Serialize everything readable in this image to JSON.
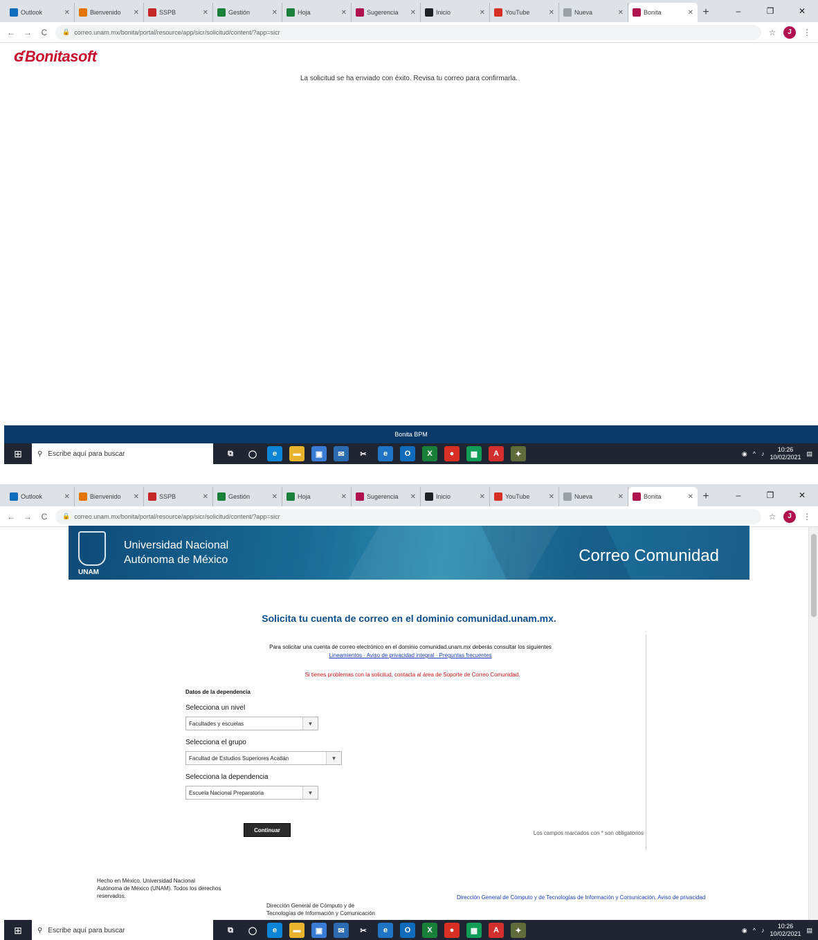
{
  "browser": {
    "tabs": [
      {
        "title": "Outlook",
        "color": "#0f6cbd"
      },
      {
        "title": "Bienvenido",
        "color": "#e37400"
      },
      {
        "title": "SSPB",
        "color": "#c62828"
      },
      {
        "title": "Gestión",
        "color": "#188038"
      },
      {
        "title": "Hoja",
        "color": "#188038"
      },
      {
        "title": "Sugerencia",
        "color": "#b0124f"
      },
      {
        "title": "Inicio",
        "color": "#202124"
      },
      {
        "title": "YouTube",
        "color": "#d93025"
      },
      {
        "title": "Nueva",
        "color": "#9aa0a6"
      },
      {
        "title": "Bonita",
        "color": "#b0124f"
      }
    ],
    "new_tab": "+",
    "url": "correo.unam.mx/bonita/portal/resource/app/sicr/solicitud/content/?app=sicr",
    "profile_initial": "J",
    "back": "←",
    "forward": "→",
    "reload": "C",
    "minimize": "–",
    "maximize": "❐",
    "close": "✕"
  },
  "bonita": {
    "logo_text": "Bonitasoft",
    "message": "La solicitud se ha enviado con éxito. Revisa tu correo para confirmarla.",
    "footer_text": "Bonita BPM"
  },
  "taskbar": {
    "search_placeholder": "Escribe aquí para buscar",
    "time": "10:26",
    "date": "10/02/2021",
    "apps": [
      {
        "name": "task-view",
        "glyph": "⧉",
        "color": "#1f2631"
      },
      {
        "name": "cortana",
        "glyph": "◯",
        "color": "#1f2631"
      },
      {
        "name": "edge",
        "glyph": "e",
        "color": "#0a84d6"
      },
      {
        "name": "explorer",
        "glyph": "▬",
        "color": "#e8b42d"
      },
      {
        "name": "store",
        "glyph": "▣",
        "color": "#3a7bd5"
      },
      {
        "name": "mail",
        "glyph": "✉",
        "color": "#2b6cb0"
      },
      {
        "name": "snip",
        "glyph": "✂",
        "color": "#1f2631"
      },
      {
        "name": "ie",
        "glyph": "e",
        "color": "#1f73c4"
      },
      {
        "name": "outlook",
        "glyph": "O",
        "color": "#0f6cbd"
      },
      {
        "name": "excel",
        "glyph": "X",
        "color": "#188038"
      },
      {
        "name": "chrome",
        "glyph": "●",
        "color": "#d93025"
      },
      {
        "name": "sheets",
        "glyph": "▦",
        "color": "#0f9d58"
      },
      {
        "name": "acrobat",
        "glyph": "A",
        "color": "#d32f2f"
      },
      {
        "name": "app",
        "glyph": "✦",
        "color": "#5f6b3a"
      }
    ]
  },
  "unam": {
    "university_line1": "Universidad Nacional",
    "university_line2": "Autónoma de México",
    "abbr": "UNAM",
    "service": "Correo Comunidad",
    "form_title": "Solicita tu cuenta de correo en el dominio comunidad.unam.mx.",
    "intro": "Para solicitar una cuenta de correo electrónico en el dominio comunidad.unam.mx deberás consultar los siguientes",
    "intro_links": "Lineamientos · Aviso de privacidad integral · Preguntas frecuentes",
    "warning": "Si tienes problemas con la solicitud, contacta al área de Soporte de Correo Comunidad.",
    "section_label": "Datos de la dependencia",
    "level_label": "Selecciona un nivel",
    "level_value": "Facultades y escuelas",
    "group_label": "Selecciona el grupo",
    "group_value": "Facultad de Estudios Superiores Acatlán",
    "dependency_label": "Selecciona la dependencia",
    "dependency_value": "Escuela Nacional Preparatoria",
    "submit": "Continuar",
    "side_note": "Los campos marcados con * son obligatorios",
    "footer_col1": "Hecho en México. Universidad Nacional Autónoma de México (UNAM). Todos los derechos reservados.",
    "footer_col2": "Dirección General de Cómputo y de Tecnologías de Información y Comunicación",
    "footer_col3": "Dirección General de Cómputo y de Tecnologías de Información y Comunicación. Aviso de privacidad"
  }
}
